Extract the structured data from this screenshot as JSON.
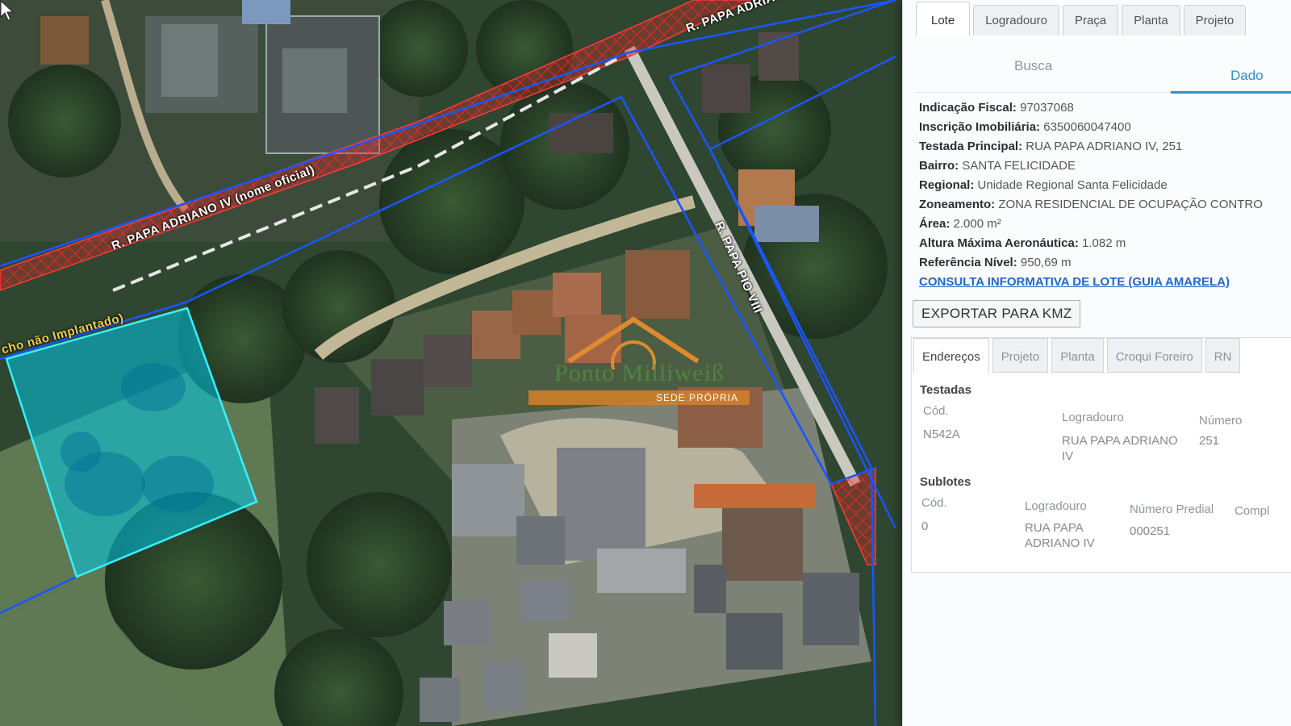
{
  "map": {
    "road_label_1": "R. PAPA ADRIANO IV (nome oficial)",
    "road_label_2": "R. PAPA ADRIANO IV",
    "road_label_3": "R. PAPA PIO VIII",
    "road_label_4": "cho não Implantado)",
    "watermark_title": "Ponto Milliweiß",
    "watermark_sub": "SEDE PRÓPRIA"
  },
  "panel": {
    "tabs": [
      "Lote",
      "Logradouro",
      "Praça",
      "Planta",
      "Projeto"
    ],
    "subtabs": [
      "Busca",
      "Dado"
    ],
    "info": {
      "indicacao_fiscal_label": "Indicação Fiscal:",
      "indicacao_fiscal": "97037068",
      "inscricao_label": "Inscrição Imobiliária:",
      "inscricao": "6350060047400",
      "testada_label": "Testada Principal:",
      "testada": "RUA PAPA ADRIANO IV, 251",
      "bairro_label": "Bairro:",
      "bairro": "SANTA FELICIDADE",
      "regional_label": "Regional:",
      "regional": "Unidade Regional Santa Felicidade",
      "zoneamento_label": "Zoneamento:",
      "zoneamento": "ZONA RESIDENCIAL DE OCUPAÇÃO CONTRO",
      "area_label": "Área:",
      "area": "2.000 m²",
      "altura_label": "Altura Máxima Aeronáutica:",
      "altura": "1.082 m",
      "referencia_label": "Referência Nível:",
      "referencia": "950,69 m",
      "link": "CONSULTA INFORMATIVA DE LOTE (GUIA AMARELA)"
    },
    "export_button": "EXPORTAR PARA KMZ",
    "tabs2": [
      "Endereços",
      "Projeto",
      "Planta",
      "Croqui Foreiro",
      "RN"
    ],
    "testadas": {
      "title": "Testadas",
      "headers": [
        "Cód.",
        "Logradouro",
        "Número"
      ],
      "row": {
        "cod": "N542A",
        "logradouro": "RUA PAPA ADRIANO IV",
        "numero": "251"
      }
    },
    "sublotes": {
      "title": "Sublotes",
      "headers": [
        "Cód.",
        "Logradouro",
        "Número Predial",
        "Compl"
      ],
      "row": {
        "cod": "0",
        "logradouro": "RUA PAPA ADRIANO IV",
        "numero": "000251"
      }
    }
  }
}
